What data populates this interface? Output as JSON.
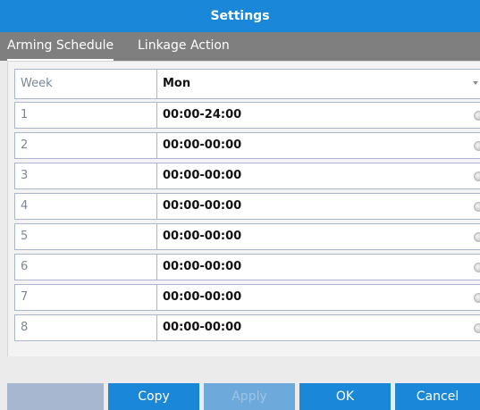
{
  "window": {
    "title": "Settings"
  },
  "tabs": [
    {
      "label": "Arming Schedule",
      "active": true
    },
    {
      "label": "Linkage Action",
      "active": false
    }
  ],
  "schedule": {
    "week_label": "Week",
    "week_value": "Mon",
    "periods": [
      {
        "label": "1",
        "time": "00:00-24:00"
      },
      {
        "label": "2",
        "time": "00:00-00:00"
      },
      {
        "label": "3",
        "time": "00:00-00:00"
      },
      {
        "label": "4",
        "time": "00:00-00:00"
      },
      {
        "label": "5",
        "time": "00:00-00:00"
      },
      {
        "label": "6",
        "time": "00:00-00:00"
      },
      {
        "label": "7",
        "time": "00:00-00:00"
      },
      {
        "label": "8",
        "time": "00:00-00:00"
      }
    ]
  },
  "buttons": {
    "copy": "Copy",
    "apply": "Apply",
    "ok": "OK",
    "cancel": "Cancel"
  },
  "colors": {
    "titlebar": "#1a87d9",
    "tabbar": "#7f7f7f",
    "button": "#1a87d9",
    "button_disabled": "#6ea9dc",
    "row_border": "#a9b7cc"
  }
}
